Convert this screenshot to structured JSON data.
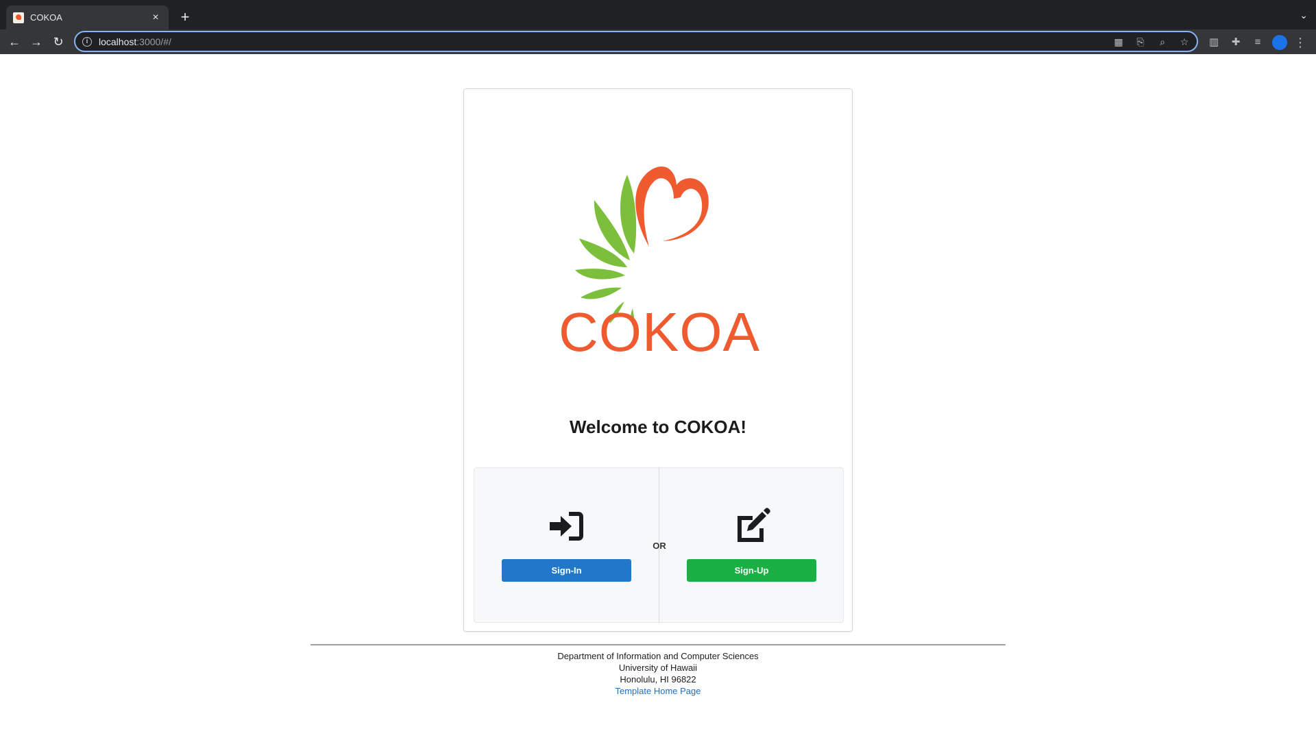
{
  "browser": {
    "tab_title": "COKOA",
    "tab_close": "×",
    "new_tab": "+",
    "tab_search": "⌄",
    "url_host": "localhost",
    "url_rest": ":3000/#/",
    "nav": {
      "back": "←",
      "forward": "→",
      "reload": "↻"
    }
  },
  "page": {
    "logo_text": "COKOA",
    "welcome": "Welcome to COKOA!",
    "or_label": "OR",
    "signin_label": "Sign-In",
    "signup_label": "Sign-Up"
  },
  "footer": {
    "line1": "Department of Information and Computer Sciences",
    "line2": "University of Hawaii",
    "line3": "Honolulu, HI 96822",
    "link": "Template Home Page"
  },
  "colors": {
    "brand_orange": "#ef5a2f",
    "leaf_green": "#7cbf3c",
    "signin_blue": "#2277c9",
    "signup_green": "#1bb043"
  }
}
